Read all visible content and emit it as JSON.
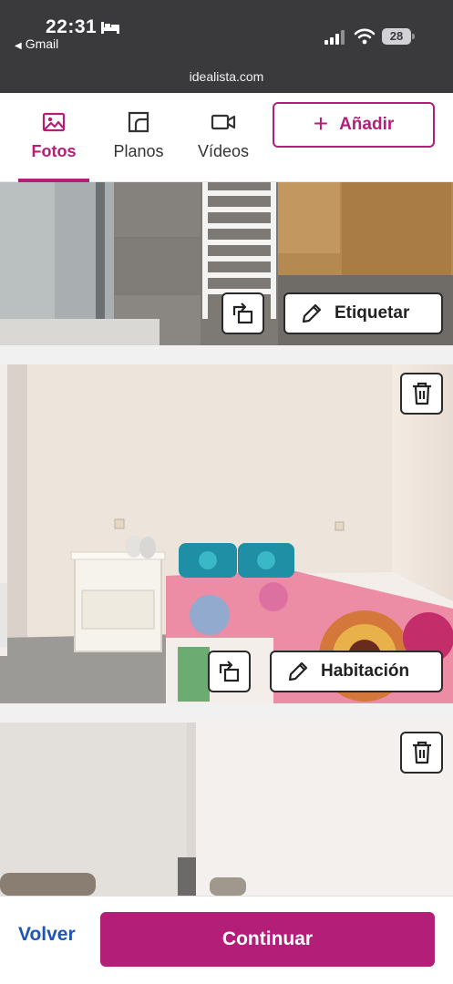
{
  "status_bar": {
    "time": "22:31",
    "back_app": "Gmail",
    "battery": "28",
    "url": "idealista.com"
  },
  "tabs": [
    {
      "label": "Fotos",
      "icon": "image-icon",
      "active": true
    },
    {
      "label": "Planos",
      "icon": "floorplan-icon",
      "active": false
    },
    {
      "label": "Vídeos",
      "icon": "video-camera-icon",
      "active": false
    }
  ],
  "add_button": {
    "label": "Añadir",
    "icon": "plus-icon"
  },
  "photos": [
    {
      "subject": "bathroom",
      "tag_label": "Etiquetar",
      "has_delete": false
    },
    {
      "subject": "bedroom",
      "tag_label": "Habitación",
      "has_delete": true
    },
    {
      "subject": "living room",
      "has_delete": true
    }
  ],
  "footer": {
    "back_label": "Volver",
    "continue_label": "Continuar"
  },
  "colors": {
    "brand": "#b31e78",
    "link": "#1f56b5",
    "status_bar": "#3a3a3c"
  }
}
